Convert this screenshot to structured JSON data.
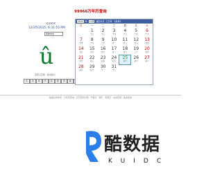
{
  "header": {
    "title": "99966万年历查询"
  },
  "left_panel": {
    "label": "北京时间",
    "datetime": "12/25/2025, 6:31:55 PM",
    "select_value": "简体中文",
    "glyph": "û",
    "footer_text": "农历乙巳年 · 冬月初六"
  },
  "buttons": [
    "今",
    "月",
    "年",
    "节",
    "农",
    "阳",
    "历",
    "前",
    "后"
  ],
  "calendar": {
    "header_items": [
      "2025",
      "年",
      "12月",
      "返回今天",
      "乙巳年",
      "【蛇年】"
    ],
    "weekdays": [
      "日",
      "一",
      "二",
      "三",
      "四",
      "五",
      "六"
    ],
    "rows": [
      [
        {
          "n": "",
          "s": ""
        },
        {
          "n": "1",
          "s": "十二"
        },
        {
          "n": "2",
          "s": "十三"
        },
        {
          "n": "3",
          "s": "十四"
        },
        {
          "n": "4",
          "s": "十五"
        },
        {
          "n": "5",
          "s": "十六"
        },
        {
          "n": "6",
          "s": "十七"
        }
      ],
      [
        {
          "n": "7",
          "s": "大雪"
        },
        {
          "n": "8",
          "s": "十九"
        },
        {
          "n": "9",
          "s": "二十"
        },
        {
          "n": "10",
          "s": "廿一"
        },
        {
          "n": "11",
          "s": "廿二"
        },
        {
          "n": "12",
          "s": "廿三"
        },
        {
          "n": "13",
          "s": "廿四"
        }
      ],
      [
        {
          "n": "14",
          "s": "廿五"
        },
        {
          "n": "15",
          "s": "廿六"
        },
        {
          "n": "16",
          "s": "廿七"
        },
        {
          "n": "17",
          "s": "廿八"
        },
        {
          "n": "18",
          "s": "廿九"
        },
        {
          "n": "19",
          "s": "三十"
        },
        {
          "n": "20",
          "s": "冬月"
        }
      ],
      [
        {
          "n": "21",
          "s": "冬至"
        },
        {
          "n": "22",
          "s": "初三"
        },
        {
          "n": "23",
          "s": "初四"
        },
        {
          "n": "24",
          "s": "初五"
        },
        {
          "n": "25",
          "s": "初六"
        },
        {
          "n": "26",
          "s": "初七"
        },
        {
          "n": "27",
          "s": "初八"
        }
      ],
      [
        {
          "n": "28",
          "s": "初九"
        },
        {
          "n": "29",
          "s": "初十"
        },
        {
          "n": "30",
          "s": "十一"
        },
        {
          "n": "31",
          "s": "十二"
        },
        {
          "n": "",
          "s": ""
        },
        {
          "n": "",
          "s": ""
        },
        {
          "n": "",
          "s": ""
        }
      ]
    ],
    "today": "25"
  },
  "footer": {
    "text": "数据仅供参考 · 万年历查询 · 农历阳历对照 · 节假日 · 黄历 · 老黄历 · 在线查询 · 免费使用"
  },
  "logo": {
    "main": "酷数据",
    "sub": "KUIDC"
  },
  "colors": {
    "accent": "#3e5ea0",
    "title_red": "#d40000",
    "green": "#0a7a2a",
    "logo_blue": "#2b7de9"
  }
}
